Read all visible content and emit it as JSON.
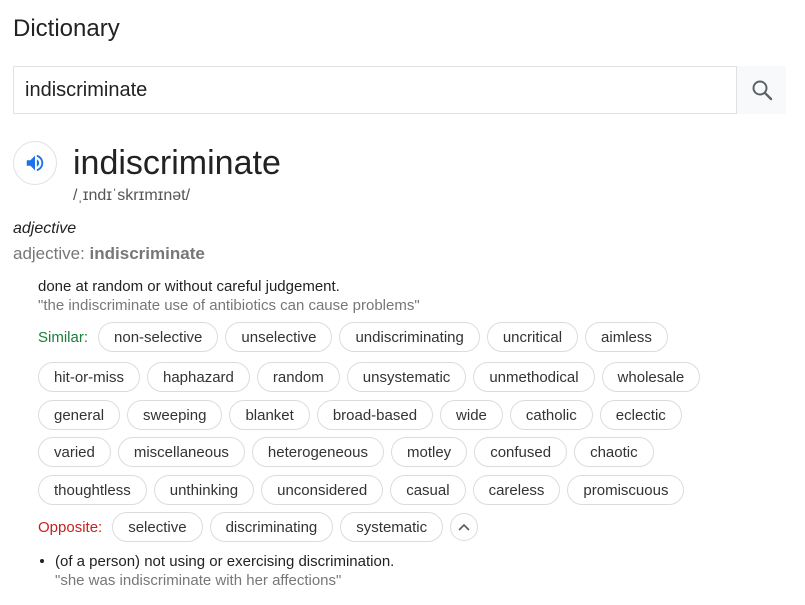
{
  "title": "Dictionary",
  "search": {
    "value": "indiscriminate",
    "icon": "search-icon"
  },
  "entry": {
    "speaker_icon": "speaker-icon",
    "word": "indiscriminate",
    "phonetic": "/ˌɪndɪˈskrɪmɪnət/",
    "part_of_speech": "adjective",
    "pos_label": "adjective: ",
    "pos_word": "indiscriminate",
    "senses": [
      {
        "definition": "done at random or without careful judgement.",
        "example": "\"the indiscriminate use of antibiotics can cause problems\"",
        "similar_label": "Similar:",
        "similar_rows": [
          [
            "non-selective",
            "unselective",
            "undiscriminating",
            "uncritical",
            "aimless"
          ],
          [
            "hit-or-miss",
            "haphazard",
            "random",
            "unsystematic",
            "unmethodical",
            "wholesale"
          ],
          [
            "general",
            "sweeping",
            "blanket",
            "broad-based",
            "wide",
            "catholic",
            "eclectic"
          ],
          [
            "varied",
            "miscellaneous",
            "heterogeneous",
            "motley",
            "confused",
            "chaotic"
          ],
          [
            "thoughtless",
            "unthinking",
            "unconsidered",
            "casual",
            "careless",
            "promiscuous"
          ]
        ],
        "opposite_label": "Opposite:",
        "opposites": [
          "selective",
          "discriminating",
          "systematic"
        ]
      },
      {
        "definition": "(of a person) not using or exercising discrimination.",
        "example": "\"she was indiscriminate with her affections\""
      }
    ]
  }
}
